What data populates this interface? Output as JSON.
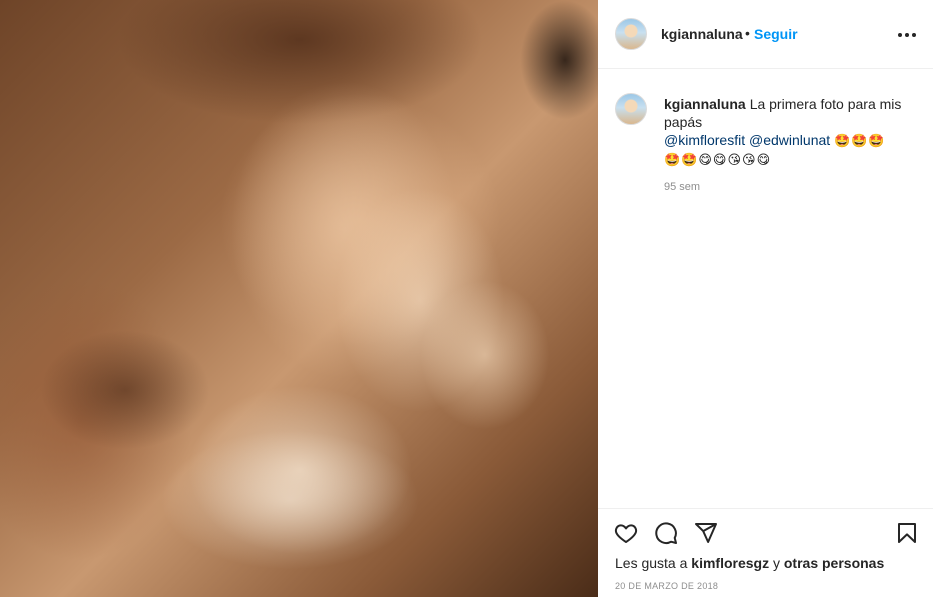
{
  "photo": {
    "icon": "ultrasound-photo"
  },
  "header": {
    "username": "kgiannaluna",
    "separator": "•",
    "follow_label": "Seguir",
    "more_icon": "more-horizontal-icon"
  },
  "caption": {
    "username": "kgiannaluna",
    "text": "La primera foto para mis papás",
    "mention_1": "@kimfloresfit",
    "mention_2": "@edwinlunat",
    "emojis_line1": "🤩🤩🤩",
    "emojis_line2": "🤩🤩😋😋😘😘😋",
    "age": "95 sem"
  },
  "actions": {
    "like_icon": "heart-icon",
    "comment_icon": "comment-icon",
    "share_icon": "share-icon",
    "save_icon": "bookmark-icon"
  },
  "likes": {
    "prefix": "Les gusta a",
    "user": "kimfloresgz",
    "conj": "y",
    "others": "otras personas"
  },
  "date": "20 DE MARZO DE 2018",
  "colors": {
    "link": "#0095f6",
    "mention": "#00376b",
    "muted": "#8e8e8e"
  }
}
